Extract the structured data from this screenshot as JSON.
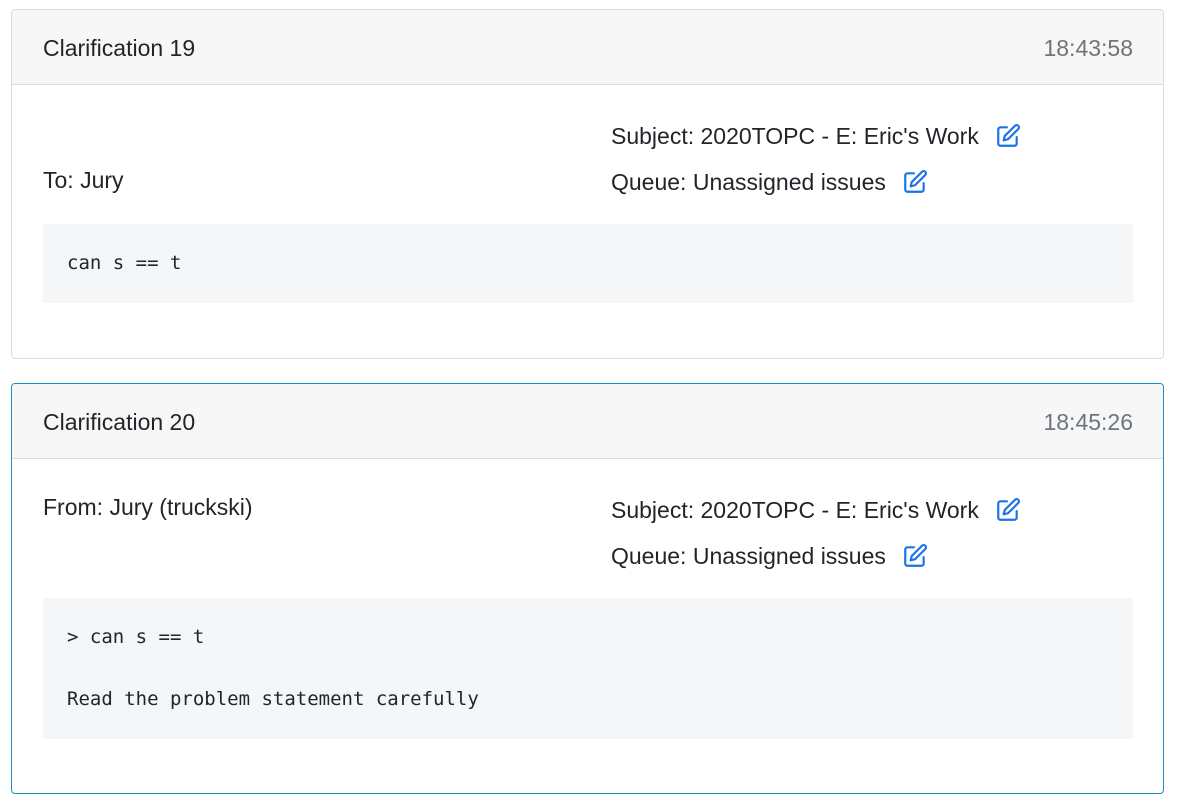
{
  "clarifications": [
    {
      "title": "Clarification 19",
      "time": "18:43:58",
      "recipient": "To: Jury",
      "subject": "Subject: 2020TOPC - E: Eric's Work",
      "queue": "Queue: Unassigned issues",
      "message_lines": [
        "can s == t"
      ]
    },
    {
      "title": "Clarification 20",
      "time": "18:45:26",
      "sender": "From: Jury (truckski)",
      "subject": "Subject: 2020TOPC - E: Eric's Work",
      "queue": "Queue: Unassigned issues",
      "message_lines": [
        "> can s == t",
        "Read the problem statement carefully"
      ]
    }
  ],
  "icons": {
    "edit": "edit-icon",
    "accent_color": "#1a73e8"
  },
  "colors": {
    "highlight_border": "#1a8fc4",
    "header_bg": "#f7f7f7",
    "message_bg": "#f5f6f8",
    "timestamp": "#6c757d"
  }
}
